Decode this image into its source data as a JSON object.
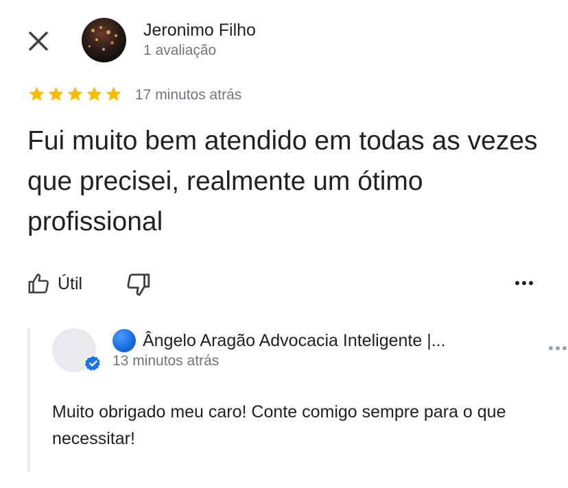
{
  "reviewer": {
    "name": "Jeronimo Filho",
    "meta": "1 avaliação"
  },
  "review": {
    "rating": 5,
    "rating_max": 5,
    "time": "17 minutos atrás",
    "text": "Fui muito bem atendido em todas as vezes que precisei, realmente um ótimo profissional"
  },
  "actions": {
    "useful_label": "Útil"
  },
  "reply": {
    "owner_name": "Ângelo Aragão Advocacia Inteligente |...",
    "time": "13 minutos atrás",
    "text": "Muito obrigado meu caro! Conte comigo sempre para o que necessitar!"
  },
  "colors": {
    "star": "#fbbc04",
    "text_primary": "#202124",
    "text_secondary": "#70757a",
    "verified": "#1a73e8",
    "reply_bar": "#e8eaed"
  },
  "icons": {
    "close": "close-icon",
    "thumbs_up": "thumbs-up-icon",
    "thumbs_down": "thumbs-down-icon",
    "more": "more-horiz-icon",
    "verified": "verified-check-icon"
  }
}
